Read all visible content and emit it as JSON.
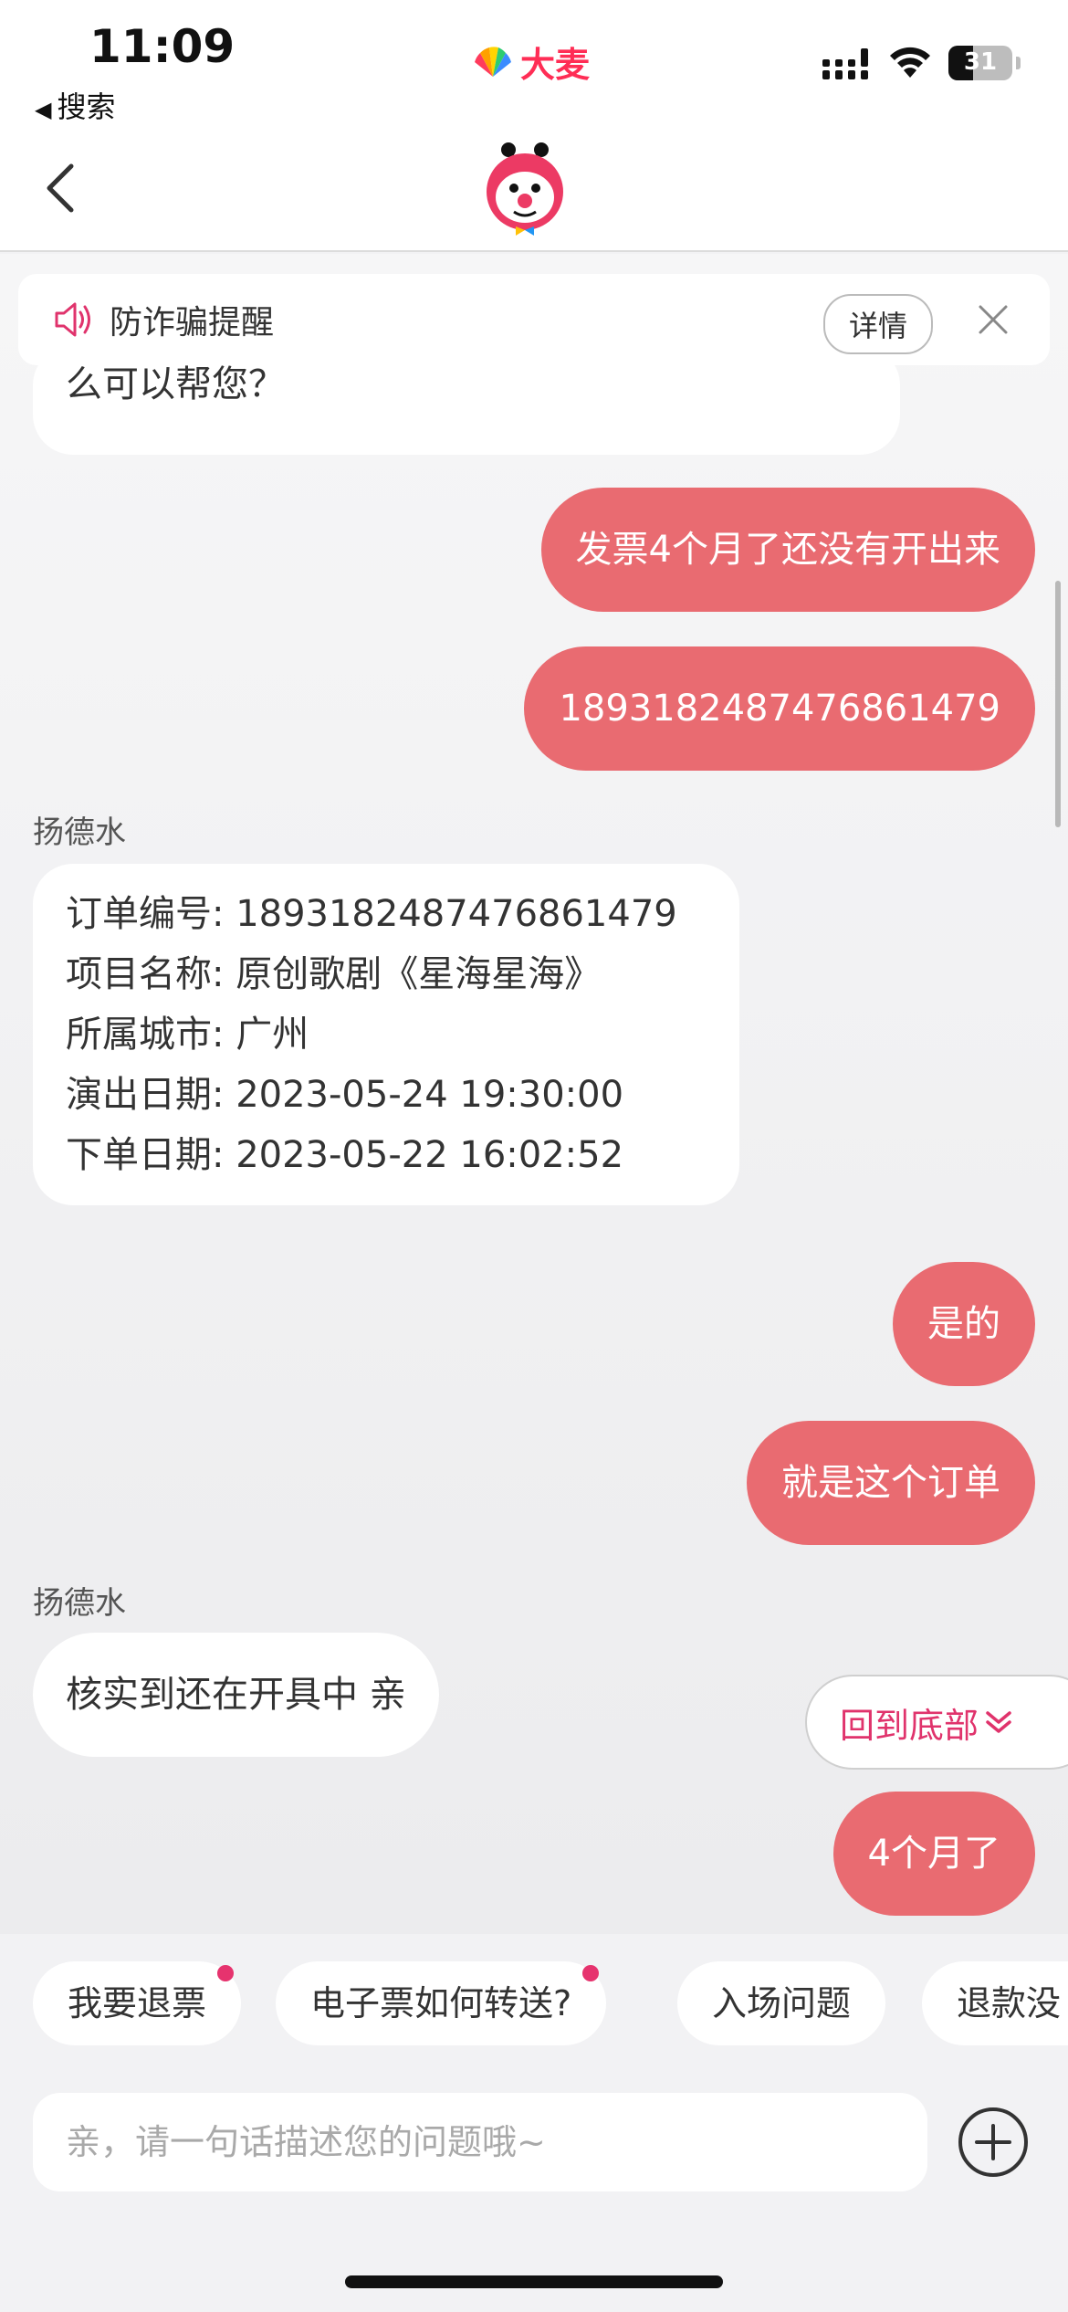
{
  "status": {
    "time": "11:09",
    "back_app": "搜索",
    "brand": "大麦",
    "battery": "31"
  },
  "notice": {
    "text": "防诈骗提醒",
    "detail": "详情"
  },
  "messages": {
    "partial": "么可以帮您？",
    "m1": "发票4个月了还没有开出来",
    "m2": "1893182487476861479",
    "sender1": "扬德水",
    "order_lines": [
      "订单编号: 1893182487476861479",
      "项目名称: 原创歌剧《星海星海》",
      "所属城市: 广州",
      "演出日期: 2023-05-24 19:30:00",
      "下单日期: 2023-05-22 16:02:52"
    ],
    "m3": "是的",
    "m4": "就是这个订单",
    "sender2": "扬德水",
    "m5": "核实到还在开具中 亲",
    "m6": "4个月了"
  },
  "back_to_bottom": "回到底部",
  "quick_replies": [
    "我要退票",
    "电子票如何转送?",
    "入场问题",
    "退款没"
  ],
  "input": {
    "placeholder": "亲，请一句话描述您的问题哦~"
  },
  "colors": {
    "bubble_user": "#e96b71",
    "accent": "#e0336c"
  }
}
